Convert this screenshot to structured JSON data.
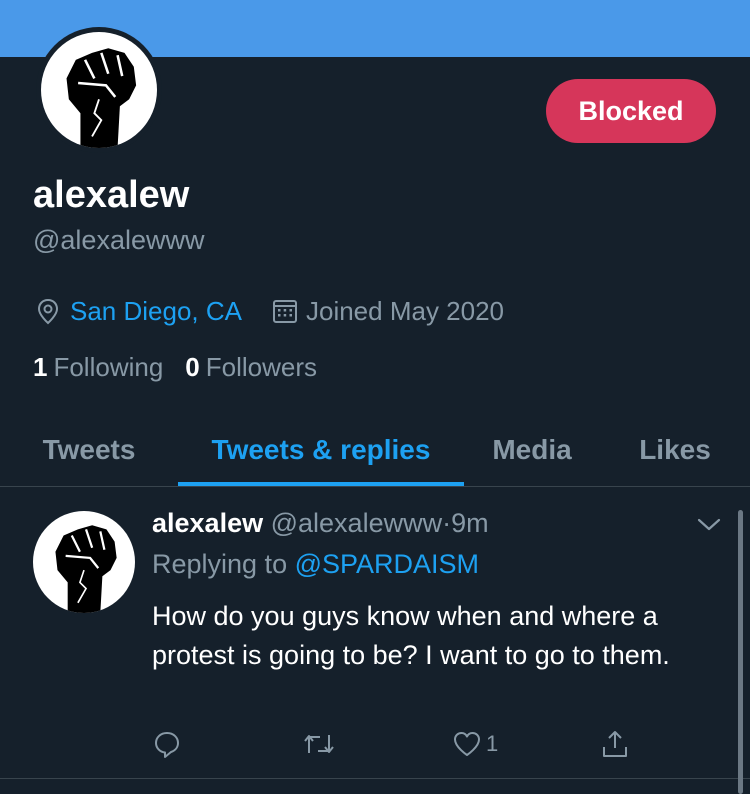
{
  "profile": {
    "display_name": "alexalew",
    "handle": "@alexalewww",
    "location": "San Diego, CA",
    "joined": "Joined May 2020",
    "following_count": "1",
    "following_label": "Following",
    "followers_count": "0",
    "followers_label": "Followers",
    "blocked_label": "Blocked"
  },
  "tabs": [
    {
      "label": "Tweets",
      "active": false
    },
    {
      "label": "Tweets & replies",
      "active": true
    },
    {
      "label": "Media",
      "active": false
    },
    {
      "label": "Likes",
      "active": false
    }
  ],
  "tweet": {
    "name": "alexalew",
    "handle": "@alexalewww",
    "dot": "·",
    "time": "9m",
    "replying_prefix": "Replying to",
    "replying_to": "@SPARDAISM",
    "text": "How do you guys know when and where a protest is going to be? I want to go to them.",
    "like_count": "1"
  },
  "icons": {
    "avatar": "raised-fist-icon",
    "location": "location-pin-icon",
    "joined": "calendar-icon",
    "reply": "reply-bubble-icon",
    "retweet": "retweet-icon",
    "like": "heart-icon",
    "share": "share-icon",
    "menu": "chevron-down-icon"
  },
  "colors": {
    "background": "#15202b",
    "banner": "#4a99e9",
    "accent": "#1da1f2",
    "blocked": "#d6365a",
    "secondary_text": "#8899a6"
  }
}
